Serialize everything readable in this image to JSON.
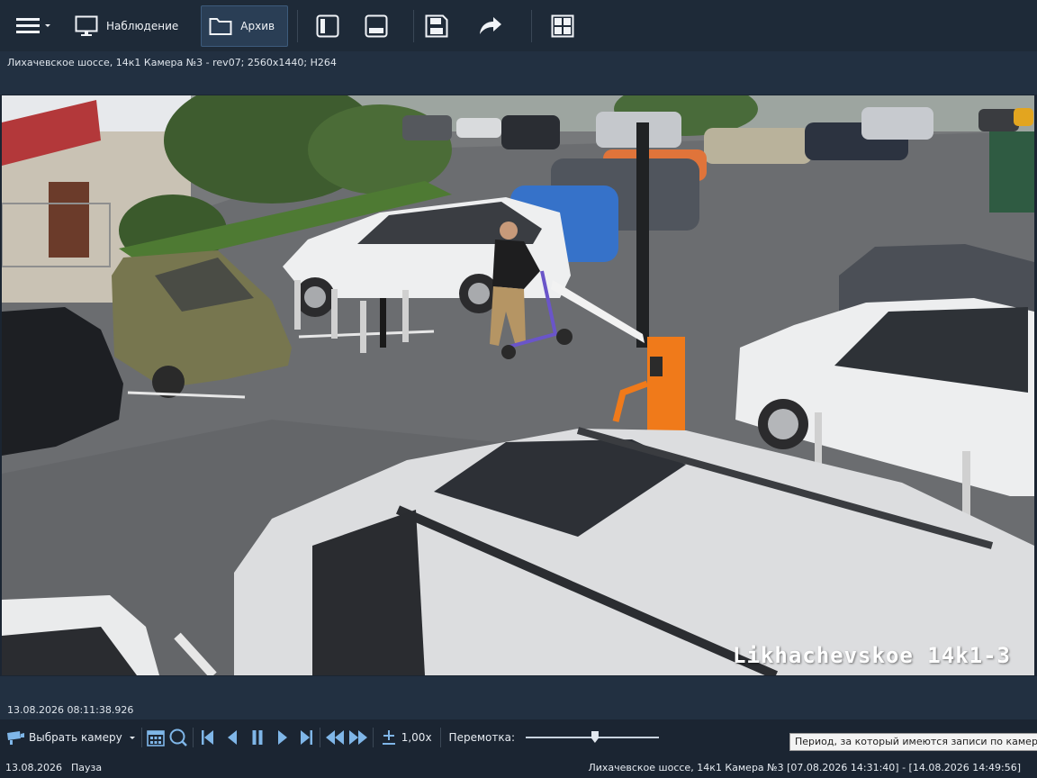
{
  "toolbar": {
    "monitoring_label": "Наблюдение",
    "archive_label": "Архив",
    "icons": [
      "menu-icon",
      "monitor-icon",
      "folder-icon",
      "split-vertical-icon",
      "split-horizontal-icon",
      "save-icon",
      "share-icon",
      "grid-icon"
    ]
  },
  "camera": {
    "info": "Лихачевское шоссе, 14к1  Камера №3 - rev07; 2560x1440; H264",
    "overlay_text": "Likhachevskoe 14k1-3"
  },
  "timeline": {
    "timestamp": "13.08.2026 08:11:38.926"
  },
  "controls": {
    "select_camera_label": "Выбрать камеру",
    "speed": "1,00x",
    "rewind_label": "Перемотка:",
    "rewind_position": 0.52
  },
  "tooltip": {
    "text": "Период, за который имеются записи по камере"
  },
  "status": {
    "date": "13.08.2026",
    "state": "Пауза",
    "camera_period": "Лихачевское шоссе, 14к1  Камера №3  [07.08.2026 14:31:40] - [14.08.2026 14:49:56]"
  },
  "colors": {
    "toolbar_bg": "#1e2a38",
    "panel_bg": "#223041",
    "active_button": "#2a3e55",
    "barrier_orange": "#f07a1a"
  }
}
